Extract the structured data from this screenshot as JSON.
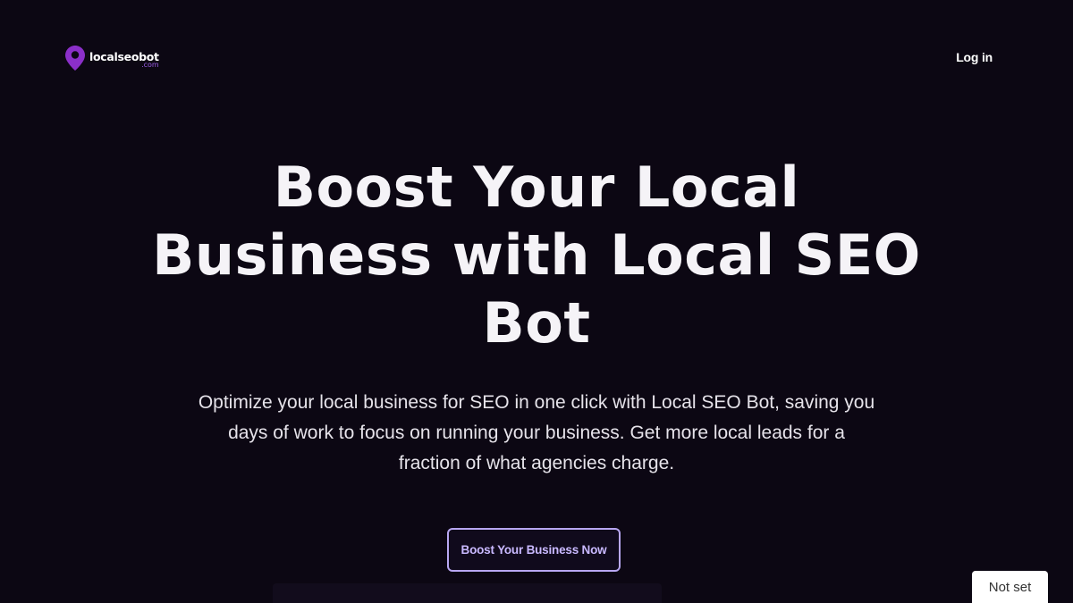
{
  "header": {
    "logo": {
      "name": "localseobot",
      "tld": ".com",
      "icon": "map-pin-icon",
      "accent": "#8b2fc9"
    },
    "login_label": "Log in"
  },
  "hero": {
    "title": "Boost Your Local Business with Local SEO Bot",
    "subtitle": "Optimize your local business for SEO in one click with Local SEO Bot, saving you days of work to focus on running your business. Get more local leads for a fraction of what agencies charge.",
    "cta_label": "Boost Your Business Now"
  },
  "status_chip": {
    "label": "Not set"
  },
  "colors": {
    "background": "#0c0713",
    "cta_border": "#b8a7f2",
    "cta_text": "#c9b9ff"
  }
}
